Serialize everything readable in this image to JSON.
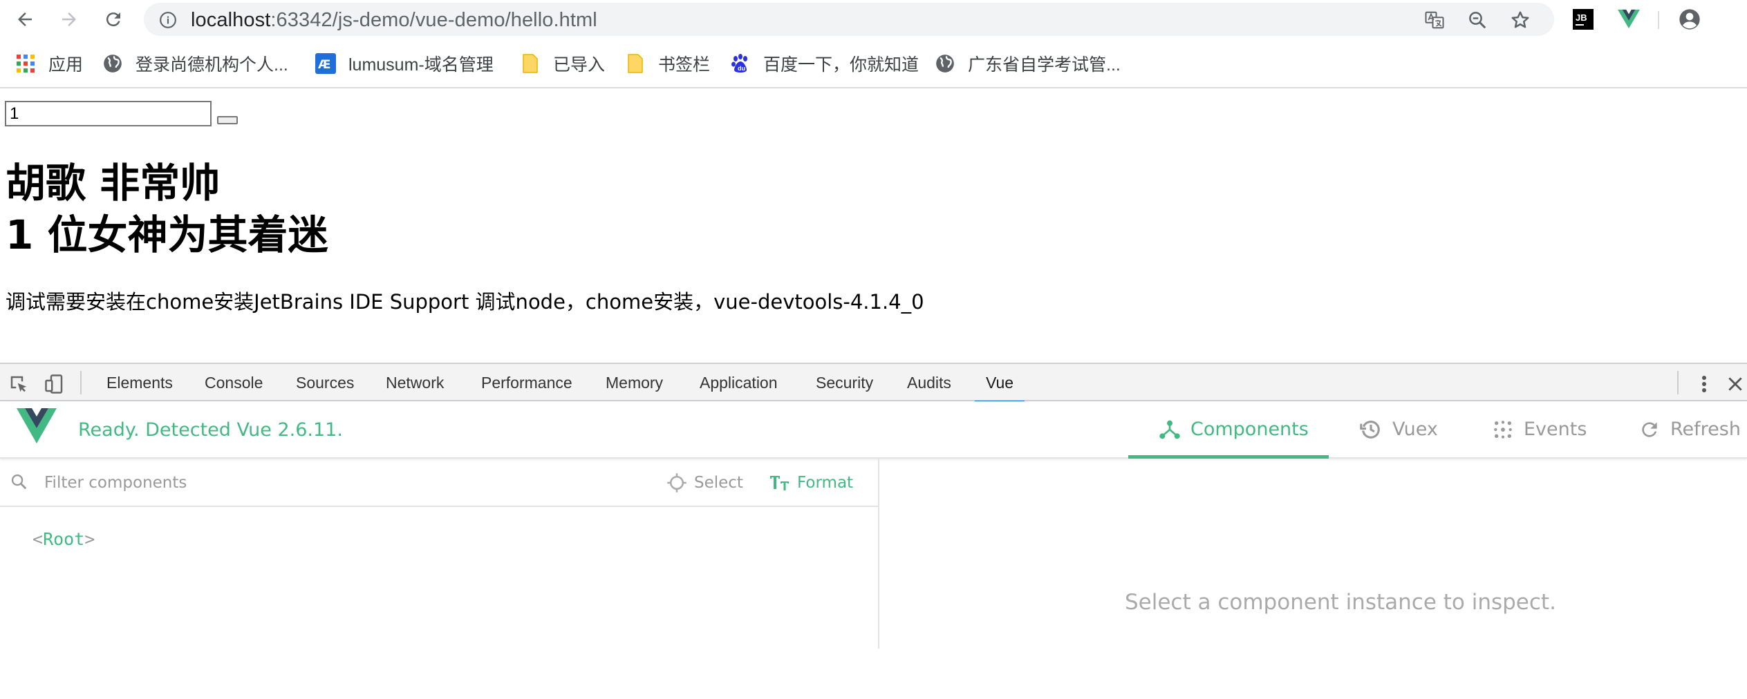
{
  "browser": {
    "url_host": "localhost",
    "url_rest": ":63342/js-demo/vue-demo/hello.html",
    "icons": [
      "back-arrow-icon",
      "forward-arrow-icon",
      "reload-icon",
      "info-icon",
      "translate-icon",
      "zoom-icon",
      "star-icon",
      "jetbrains-icon",
      "vue-devtools-icon",
      "account-icon"
    ],
    "jetbrains_text": "JB"
  },
  "bookmarks": [
    {
      "label": "应用",
      "icon": "apps-grid-icon"
    },
    {
      "label": "登录尚德机构个人...",
      "icon": "globe-icon"
    },
    {
      "label": "lumusum-域名管理",
      "icon": "site-icon"
    },
    {
      "label": "已导入",
      "icon": "folder-icon"
    },
    {
      "label": "书签栏",
      "icon": "folder-icon"
    },
    {
      "label": "百度一下，你就知道",
      "icon": "baidu-paw-icon"
    },
    {
      "label": "广东省自学考试管...",
      "icon": "globe-icon"
    }
  ],
  "page": {
    "input_value": "1",
    "heading_line1": "胡歌 非常帅",
    "heading_line2": "1 位女神为其着迷",
    "note": "调试需要安装在chome安装JetBrains IDE Support 调试node，chome安装，vue-devtools-4.1.4_0"
  },
  "devtools": {
    "tabs": [
      "Elements",
      "Console",
      "Sources",
      "Network",
      "Performance",
      "Memory",
      "Application",
      "Security",
      "Audits",
      "Vue"
    ],
    "active_tab": "Vue",
    "vue": {
      "status": "Ready. Detected Vue 2.6.11.",
      "nav": [
        "Components",
        "Vuex",
        "Events",
        "Refresh"
      ],
      "active_nav": "Components",
      "filter_placeholder": "Filter components",
      "select_label": "Select",
      "format_label": "Format",
      "root_label": "Root",
      "root_open": "<",
      "root_close": ">",
      "inspect_hint": "Select a component instance to inspect."
    },
    "colors": {
      "vue_green": "#42b983",
      "tab_active": "#1a73e8",
      "muted": "#999999"
    }
  }
}
